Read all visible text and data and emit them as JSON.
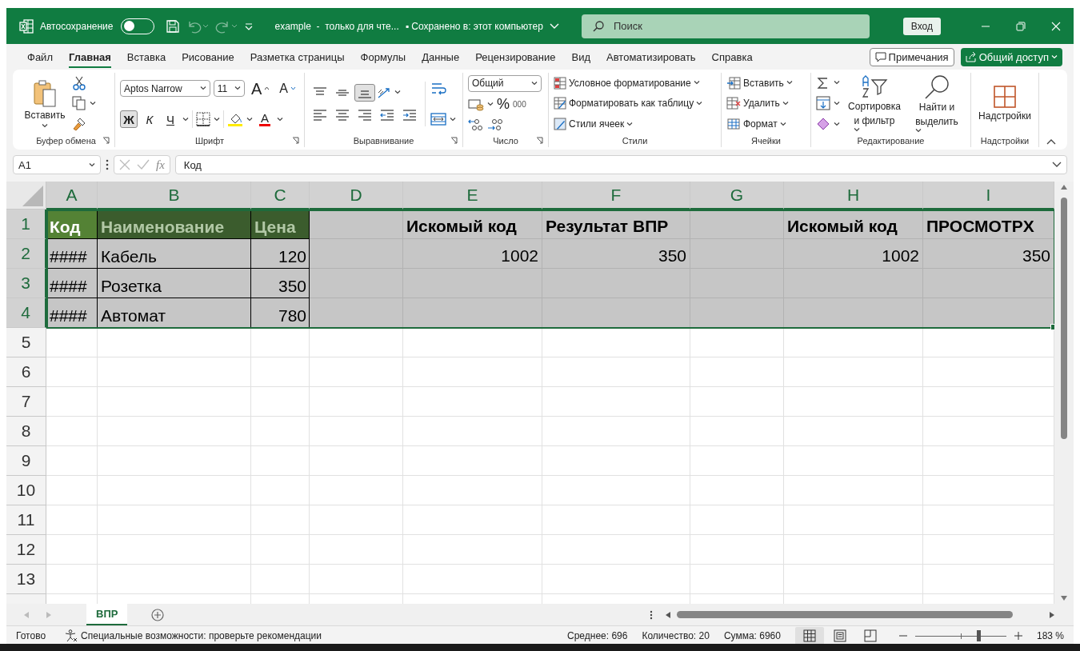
{
  "title_bar": {
    "autosave_label": "Автосохранение",
    "autosave_on": false,
    "undo_disabled": true,
    "redo_disabled": true,
    "file_name": "example  -  только для чте...",
    "save_status": "▪ Сохранено в: этот компьютер",
    "search_placeholder": "Поиск",
    "sign_in": "Вход"
  },
  "menu_tabs": [
    {
      "label": "Файл",
      "selected": false
    },
    {
      "label": "Главная",
      "selected": true
    },
    {
      "label": "Вставка",
      "selected": false
    },
    {
      "label": "Рисование",
      "selected": false
    },
    {
      "label": "Разметка страницы",
      "selected": false
    },
    {
      "label": "Формулы",
      "selected": false
    },
    {
      "label": "Данные",
      "selected": false
    },
    {
      "label": "Рецензирование",
      "selected": false
    },
    {
      "label": "Вид",
      "selected": false
    },
    {
      "label": "Автоматизировать",
      "selected": false
    },
    {
      "label": "Справка",
      "selected": false
    }
  ],
  "comments_button": "Примечания",
  "share_button": "Общий доступ",
  "ribbon": {
    "clipboard": {
      "label": "Буфер обмена",
      "paste": "Вставить"
    },
    "font": {
      "label": "Шрифт",
      "font_name": "Aptos Narrow",
      "font_size": "11",
      "grow": "A",
      "shrink": "A",
      "font_color": "A",
      "styles": [
        {
          "label": "Ж",
          "selected": true
        },
        {
          "label": "К",
          "selected": false
        },
        {
          "label": "Ч",
          "selected": false
        }
      ]
    },
    "alignment": {
      "label": "Выравнивание",
      "buttons": [
        {
          "kind": "top",
          "selected": false
        },
        {
          "kind": "middle",
          "selected": false
        },
        {
          "kind": "bottom",
          "selected": true
        },
        {
          "kind": "left",
          "selected": false
        },
        {
          "kind": "center",
          "selected": false
        },
        {
          "kind": "right",
          "selected": false
        },
        {
          "kind": "outdent",
          "selected": false
        },
        {
          "kind": "indent",
          "selected": false
        }
      ]
    },
    "number": {
      "label": "Число",
      "format": "Общий",
      "percent": "%",
      "thousands": "000"
    },
    "styles": {
      "label": "Стили",
      "items": [
        "Условное форматирование",
        "Форматировать как таблицу",
        "Стили ячеек"
      ]
    },
    "cells": {
      "label": "Ячейки",
      "items": [
        "Вставить",
        "Удалить",
        "Формат"
      ]
    },
    "editing": {
      "label": "Редактирование",
      "sort": [
        "Сортировка",
        "и фильтр"
      ],
      "find": [
        "Найти и",
        "выделить"
      ]
    },
    "addins": {
      "label": "Надстройки",
      "button": "Надстройки"
    }
  },
  "formula_bar": {
    "name_box": "A1",
    "function_button": "fx",
    "formula": "Код"
  },
  "columns": [
    {
      "label": "A",
      "selected": true
    },
    {
      "label": "B",
      "selected": true
    },
    {
      "label": "C",
      "selected": true
    },
    {
      "label": "D",
      "selected": true
    },
    {
      "label": "E",
      "selected": true
    },
    {
      "label": "F",
      "selected": true
    },
    {
      "label": "G",
      "selected": true
    },
    {
      "label": "H",
      "selected": true
    },
    {
      "label": "I",
      "selected": true
    }
  ],
  "rows": [
    {
      "number": "1",
      "selected": true,
      "cells": [
        {
          "kind": "table_header",
          "text": "Код",
          "selected": false
        },
        {
          "kind": "table_header",
          "text": "Наименование",
          "selected": true
        },
        {
          "kind": "table_header",
          "text": "Цена",
          "selected": true
        },
        {
          "kind": "empty",
          "selected": true
        },
        {
          "kind": "label",
          "text": "Искомый код",
          "selected": true
        },
        {
          "kind": "label",
          "text": "Результат ВПР",
          "selected": true
        },
        {
          "kind": "empty",
          "selected": true
        },
        {
          "kind": "label",
          "text": "Искомый код",
          "selected": true
        },
        {
          "kind": "label",
          "text": "ПРОСМОТРX",
          "selected": true
        }
      ]
    },
    {
      "number": "2",
      "selected": true,
      "cells": [
        {
          "kind": "table_text",
          "text": "####",
          "selected": true
        },
        {
          "kind": "table_text",
          "text": "Кабель",
          "selected": true
        },
        {
          "kind": "table_number",
          "text": "120",
          "selected": true
        },
        {
          "kind": "empty",
          "selected": true
        },
        {
          "kind": "number",
          "text": "1002",
          "selected": true
        },
        {
          "kind": "number",
          "text": "350",
          "selected": true
        },
        {
          "kind": "empty",
          "selected": true
        },
        {
          "kind": "number",
          "text": "1002",
          "selected": true
        },
        {
          "kind": "number",
          "text": "350",
          "selected": true
        }
      ]
    },
    {
      "number": "3",
      "selected": true,
      "cells": [
        {
          "kind": "table_text",
          "text": "####",
          "selected": true
        },
        {
          "kind": "table_text",
          "text": "Розетка",
          "selected": true
        },
        {
          "kind": "table_number",
          "text": "350",
          "selected": true
        },
        {
          "kind": "empty",
          "selected": true
        },
        {
          "kind": "empty",
          "selected": true
        },
        {
          "kind": "empty",
          "selected": true
        },
        {
          "kind": "empty",
          "selected": true
        },
        {
          "kind": "empty",
          "selected": true
        },
        {
          "kind": "empty",
          "selected": true
        }
      ]
    },
    {
      "number": "4",
      "selected": true,
      "cells": [
        {
          "kind": "table_text",
          "text": "####",
          "selected": true
        },
        {
          "kind": "table_text",
          "text": "Автомат",
          "selected": true
        },
        {
          "kind": "table_number",
          "text": "780",
          "selected": true
        },
        {
          "kind": "empty",
          "selected": true
        },
        {
          "kind": "empty",
          "selected": true
        },
        {
          "kind": "empty",
          "selected": true
        },
        {
          "kind": "empty",
          "selected": true
        },
        {
          "kind": "empty",
          "selected": true
        },
        {
          "kind": "empty",
          "selected": true
        }
      ]
    },
    {
      "number": "5",
      "selected": false
    },
    {
      "number": "6",
      "selected": false
    },
    {
      "number": "7",
      "selected": false
    },
    {
      "number": "8",
      "selected": false
    },
    {
      "number": "9",
      "selected": false
    },
    {
      "number": "10",
      "selected": false
    },
    {
      "number": "11",
      "selected": false
    },
    {
      "number": "12",
      "selected": false
    },
    {
      "number": "13",
      "selected": false
    }
  ],
  "sheet_tabs": [
    {
      "label": "ВПР",
      "selected": true
    }
  ],
  "status_bar": {
    "ready": "Готово",
    "accessibility": "Специальные возможности: проверьте рекомендации",
    "average": "Среднее: 696",
    "count": "Количество: 20",
    "sum": "Сумма: 6960",
    "views": [
      {
        "kind": "normal",
        "selected": true
      },
      {
        "kind": "page_layout",
        "selected": false
      },
      {
        "kind": "page_break",
        "selected": false
      }
    ],
    "zoom": {
      "level": 0.69,
      "reading": "183 %"
    }
  }
}
